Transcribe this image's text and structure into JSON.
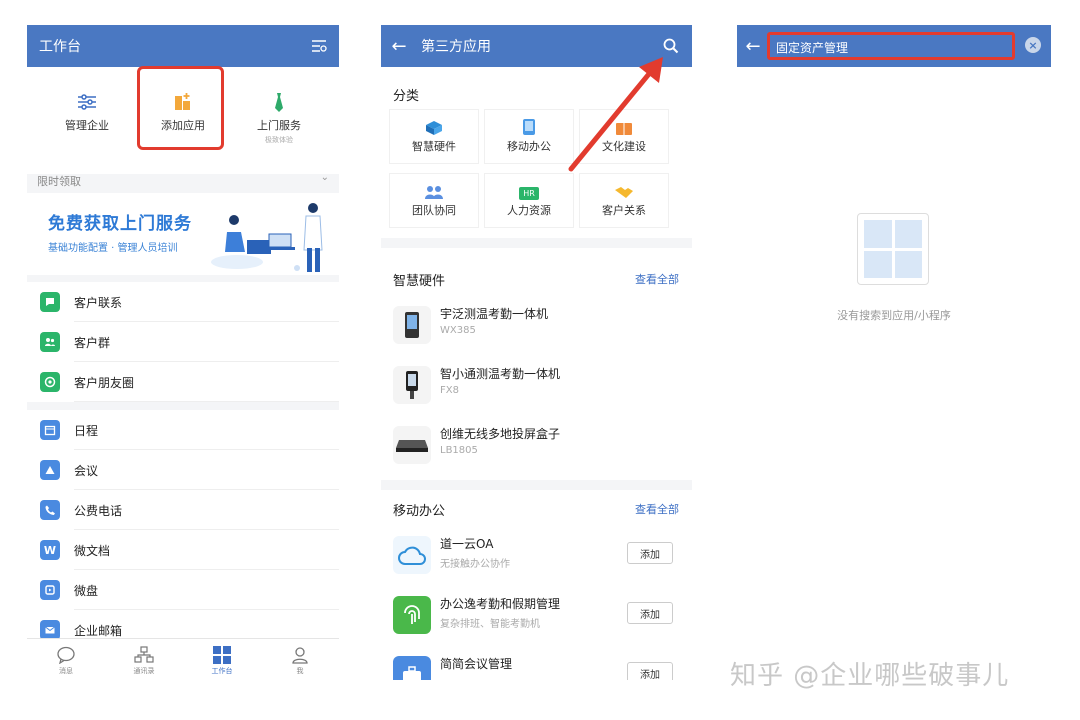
{
  "screen1": {
    "title": "工作台",
    "quick": [
      {
        "label": "管理企业",
        "sub": ""
      },
      {
        "label": "添加应用",
        "sub": ""
      },
      {
        "label": "上门服务",
        "sub": "极致体验"
      }
    ],
    "section_limited": "限时领取",
    "banner": {
      "title": "免费获取上门服务",
      "subtitle": "基础功能配置 · 管理人员培训"
    },
    "list1": [
      "客户联系",
      "客户群",
      "客户朋友圈"
    ],
    "list2": [
      "日程",
      "会议",
      "公费电话",
      "微文档",
      "微盘",
      "企业邮箱"
    ],
    "tabs": [
      "消息",
      "通讯录",
      "工作台",
      "我"
    ]
  },
  "screen2": {
    "title": "第三方应用",
    "categories_title": "分类",
    "categories": [
      "智慧硬件",
      "移动办公",
      "文化建设",
      "团队协同",
      "人力资源",
      "客户关系"
    ],
    "hr_badge": "HR",
    "view_all": "查看全部",
    "hardware_title": "智慧硬件",
    "hardware": [
      {
        "name": "宇泛测温考勤一体机",
        "desc": "WX385"
      },
      {
        "name": "智小通测温考勤一体机",
        "desc": "FX8"
      },
      {
        "name": "创维无线多地投屏盒子",
        "desc": "LB1805"
      }
    ],
    "mobile_title": "移动办公",
    "mobile": [
      {
        "name": "道一云OA",
        "desc": "无接触办公协作",
        "btn": "添加"
      },
      {
        "name": "办公逸考勤和假期管理",
        "desc": "复杂排班、智能考勤机",
        "btn": "添加"
      },
      {
        "name": "简简会议管理",
        "desc": "",
        "btn": "添加"
      }
    ]
  },
  "screen3": {
    "search_value": "固定资产管理",
    "empty_text": "没有搜索到应用/小程序"
  },
  "watermark": "知乎 @企业哪些破事儿",
  "colors": {
    "header": "#4a78c2",
    "highlight": "#e23b2e",
    "link": "#3d6fc4"
  }
}
